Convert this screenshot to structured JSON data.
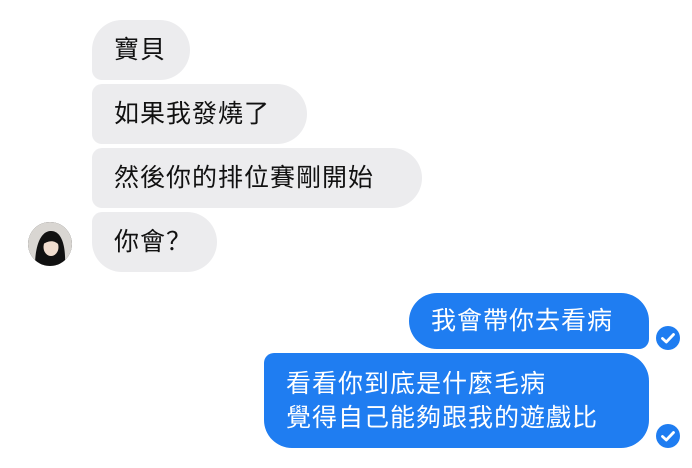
{
  "conversation": {
    "incoming": [
      {
        "text": "寶貝"
      },
      {
        "text": "如果我發燒了"
      },
      {
        "text": "然後你的排位賽剛開始"
      },
      {
        "text": "你會？"
      }
    ],
    "outgoing": [
      {
        "lines": [
          "我會帶你去看病"
        ]
      },
      {
        "lines": [
          "看看你到底是什麼毛病",
          "覺得自己能夠跟我的遊戲比"
        ]
      }
    ]
  },
  "icons": {
    "avatar": "contact-avatar",
    "read_receipt": "check-circle-icon"
  },
  "colors": {
    "incoming_bubble": "#ececee",
    "outgoing_bubble": "#1f7df1",
    "incoming_text": "#111111",
    "outgoing_text": "#ffffff",
    "background": "#ffffff"
  }
}
